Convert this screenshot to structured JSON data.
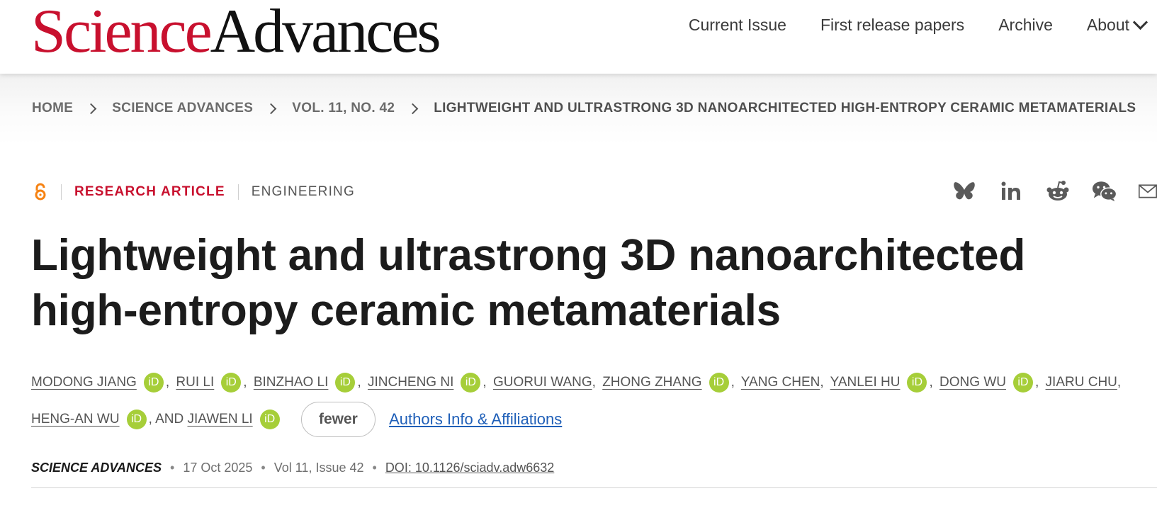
{
  "header": {
    "logo_science": "Science",
    "logo_advances": "Advances",
    "nav": [
      "Current Issue",
      "First release papers",
      "Archive",
      "About"
    ]
  },
  "breadcrumb": [
    "HOME",
    "SCIENCE ADVANCES",
    "VOL. 11, NO. 42",
    "LIGHTWEIGHT AND ULTRASTRONG 3D NANOARCHITECTED HIGH-ENTROPY CERAMIC METAMATERIALS"
  ],
  "article": {
    "type": "RESEARCH ARTICLE",
    "subject": "ENGINEERING",
    "title": "Lightweight and ultrastrong 3D nanoarchitected high-entropy ceramic metamaterials",
    "authors": [
      "MODONG JIANG",
      "RUI LI",
      "BINZHAO LI",
      "JINCHENG NI",
      "GUORUI WANG",
      "ZHONG ZHANG",
      "YANG CHEN",
      "YANLEI HU",
      "DONG WU",
      "JIARU CHU",
      "HENG-AN WU",
      "JIAWEN LI"
    ],
    "and_text": ", AND",
    "orcid_label": "iD",
    "fewer_label": "fewer",
    "affiliations_label": "Authors Info & Affiliations"
  },
  "citation": {
    "journal": "SCIENCE ADVANCES",
    "date": "17 Oct 2025",
    "volume": "Vol 11, Issue 42",
    "doi": "DOI: 10.1126/sciadv.adw6632"
  },
  "icons": {
    "open_access": "open-access-icon",
    "share": [
      "bluesky-icon",
      "linkedin-icon",
      "reddit-icon",
      "wechat-icon",
      "email-icon"
    ]
  },
  "colors": {
    "brand_red": "#c8102e",
    "orcid_green": "#a6ce39",
    "link_blue": "#1f5fb8"
  }
}
